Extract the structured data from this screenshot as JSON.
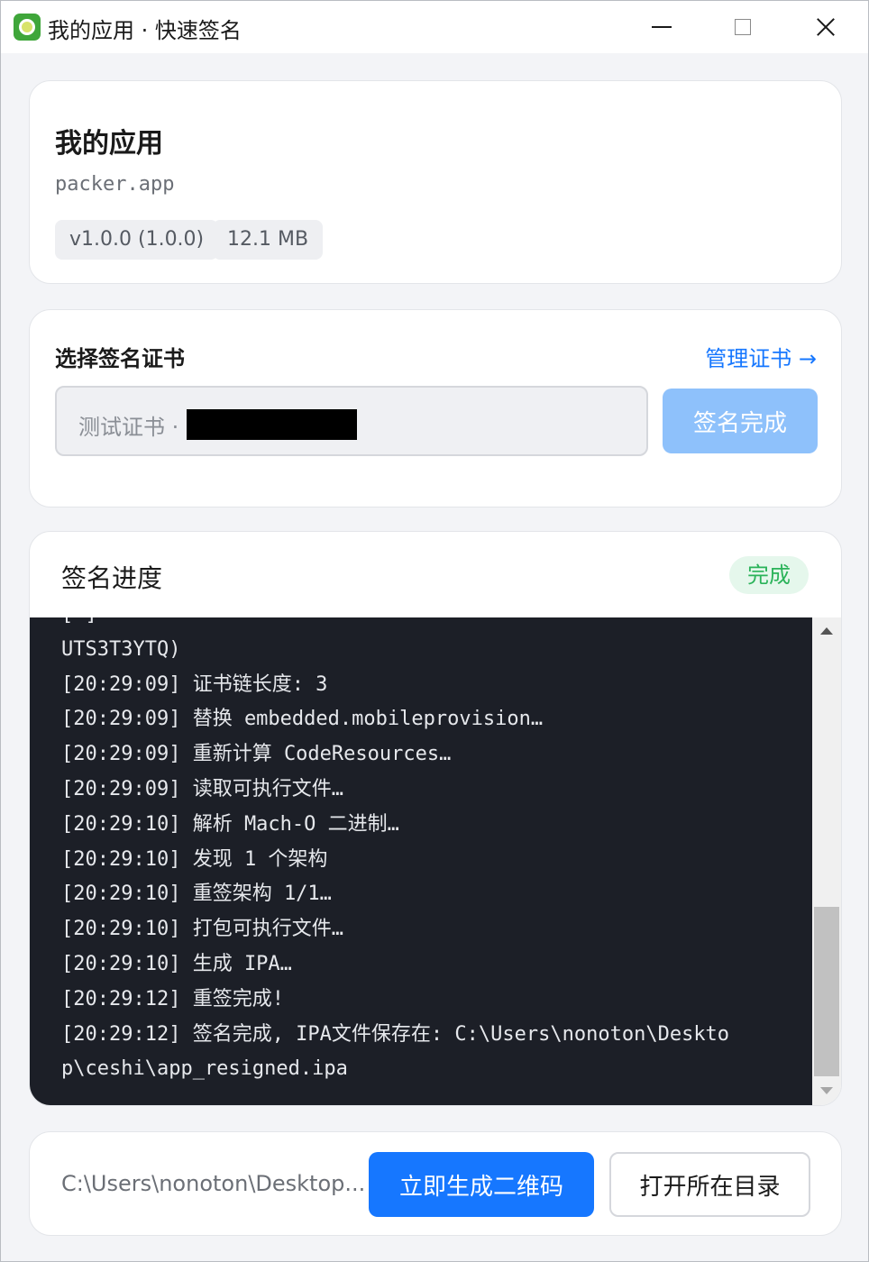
{
  "window": {
    "title": "我的应用 · 快速签名",
    "icon": "kiwi-app-icon"
  },
  "app_info": {
    "name": "我的应用",
    "bundle_id": "packer.app",
    "version_tag": "v1.0.0 (1.0.0)",
    "size_tag": "12.1 MB"
  },
  "certificate": {
    "section_title": "选择签名证书",
    "manage_link": "管理证书 →",
    "selected_value": "测试证书 ·",
    "sign_button": "签名完成"
  },
  "progress": {
    "title": "签名进度",
    "status": "完成",
    "log_lines": [
      "UTS3T3YTQ)",
      "[20:29:09] 证书链长度: 3",
      "[20:29:09] 替换 embedded.mobileprovision…",
      "[20:29:09] 重新计算 CodeResources…",
      "[20:29:09] 读取可执行文件…",
      "[20:29:10] 解析 Mach-O 二进制…",
      "[20:29:10] 发现 1 个架构",
      "[20:29:10] 重签架构 1/1…",
      "[20:29:10] 打包可执行文件…",
      "[20:29:10] 生成 IPA…",
      "[20:29:12] 重签完成!",
      "[20:29:12] 签名完成, IPA文件保存在: C:\\Users\\nonoton\\Deskto",
      "p\\ceshi\\app_resigned.ipa"
    ]
  },
  "bottom": {
    "output_path": "C:\\Users\\nonoton\\Desktop...",
    "qr_button": "立即生成二维码",
    "open_folder_button": "打开所在目录"
  },
  "colors": {
    "primary": "#1677ff",
    "primary_disabled": "#8ec1fb",
    "success": "#2bb35a",
    "log_background": "#1c1f27"
  }
}
